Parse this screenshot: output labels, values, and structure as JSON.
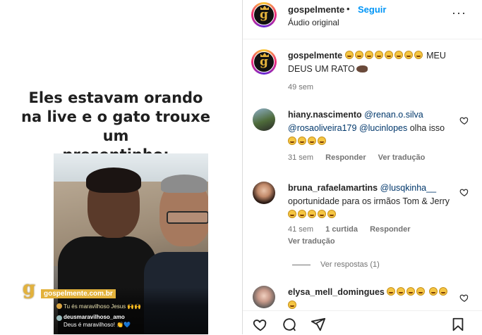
{
  "media": {
    "caption": "Eles estavam orando\nna live e o gato trouxe um\npresentinho:",
    "video_chat": [
      {
        "text": "Tu és maravilhoso Jesus 🙌🙌"
      },
      {
        "text": "deusmaravilhoso_amo"
      },
      {
        "text": "Deus é maravilhoso! 👏💙"
      }
    ],
    "watermark": {
      "logo_letter": "g",
      "text": "gospelmente.com.br"
    }
  },
  "post_header": {
    "username": "gospelmente",
    "separator": "•",
    "follow_label": "Seguir",
    "audio_label": "Áudio original",
    "more_icon": "more-dots-icon"
  },
  "caption": {
    "username": "gospelmente",
    "text_tail": "MEU DEUS UM RATO",
    "time": "49 sem",
    "laugh_emoji_count": 8
  },
  "comments": [
    {
      "username": "hiany.nascimento",
      "mention1": "@renan.o.silva",
      "mention2": "@rosaoliveira179",
      "mention3": "@lucinlopes",
      "text_tail": "olha isso",
      "time": "31 sem",
      "reply_label": "Responder",
      "translate_label": "Ver tradução"
    },
    {
      "username": "bruna_rafaelamartins",
      "mention1": "@lusqkinha__",
      "text_tail": "oportunidade para os irmãos Tom & Jerry",
      "time": "41 sem",
      "likes": "1 curtida",
      "reply_label": "Responder",
      "translate_label": "Ver tradução",
      "view_replies": "Ver respostas (1)"
    },
    {
      "username": "elysa_mell_domingues"
    }
  ],
  "actions": {
    "like_icon": "heart-icon",
    "comment_icon": "comment-icon",
    "share_icon": "share-icon",
    "save_icon": "bookmark-icon"
  }
}
